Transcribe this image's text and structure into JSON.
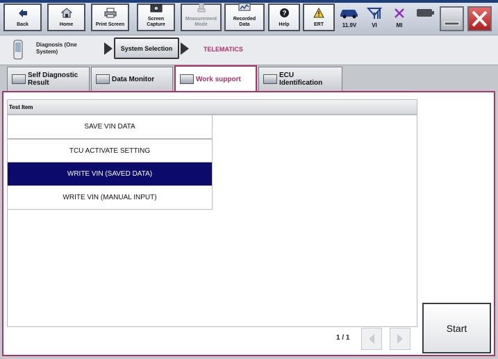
{
  "toolbar": {
    "back": "Back",
    "home": "Home",
    "print_screen": "Print Screen",
    "screen_capture_1": "Screen",
    "screen_capture_2": "Capture",
    "measurement_mode_1": "Measurement",
    "measurement_mode_2": "Mode",
    "recorded_data_1": "Recorded",
    "recorded_data_2": "Data",
    "help": "Help",
    "ert": "ERT"
  },
  "status": {
    "voltage": "11.9V",
    "vi": "VI",
    "mi": "MI"
  },
  "breadcrumb": {
    "diagnosis_1": "Diagnosis (One",
    "diagnosis_2": "System)",
    "system_selection": "System Selection",
    "current": "TELEMATICS"
  },
  "tabs": {
    "self_diag_1": "Self Diagnostic",
    "self_diag_2": "Result",
    "data_monitor": "Data Monitor",
    "work_support": "Work support",
    "ecu_id_1": "ECU",
    "ecu_id_2": "Identification"
  },
  "list": {
    "header": "Test Item",
    "items": [
      "SAVE VIN DATA",
      "TCU ACTIVATE SETTING",
      "WRITE VIN (SAVED DATA)",
      "WRITE VIN (MANUAL INPUT)"
    ],
    "selected_index": 2
  },
  "pagination": {
    "page": "1 / 1"
  },
  "start_label": "Start",
  "colors": {
    "accent": "#b0306a",
    "selection": "#0c0a6a",
    "toolbar_icon": "#1f3d6e"
  },
  "icons": [
    "back-arrow-icon",
    "home-icon",
    "printer-icon",
    "camera-icon",
    "measurement-icon",
    "recorded-data-icon",
    "help-icon",
    "warning-icon",
    "car-battery-icon",
    "signal-icon",
    "cross-icon",
    "battery-icon",
    "phone-icon",
    "tab-icon"
  ]
}
